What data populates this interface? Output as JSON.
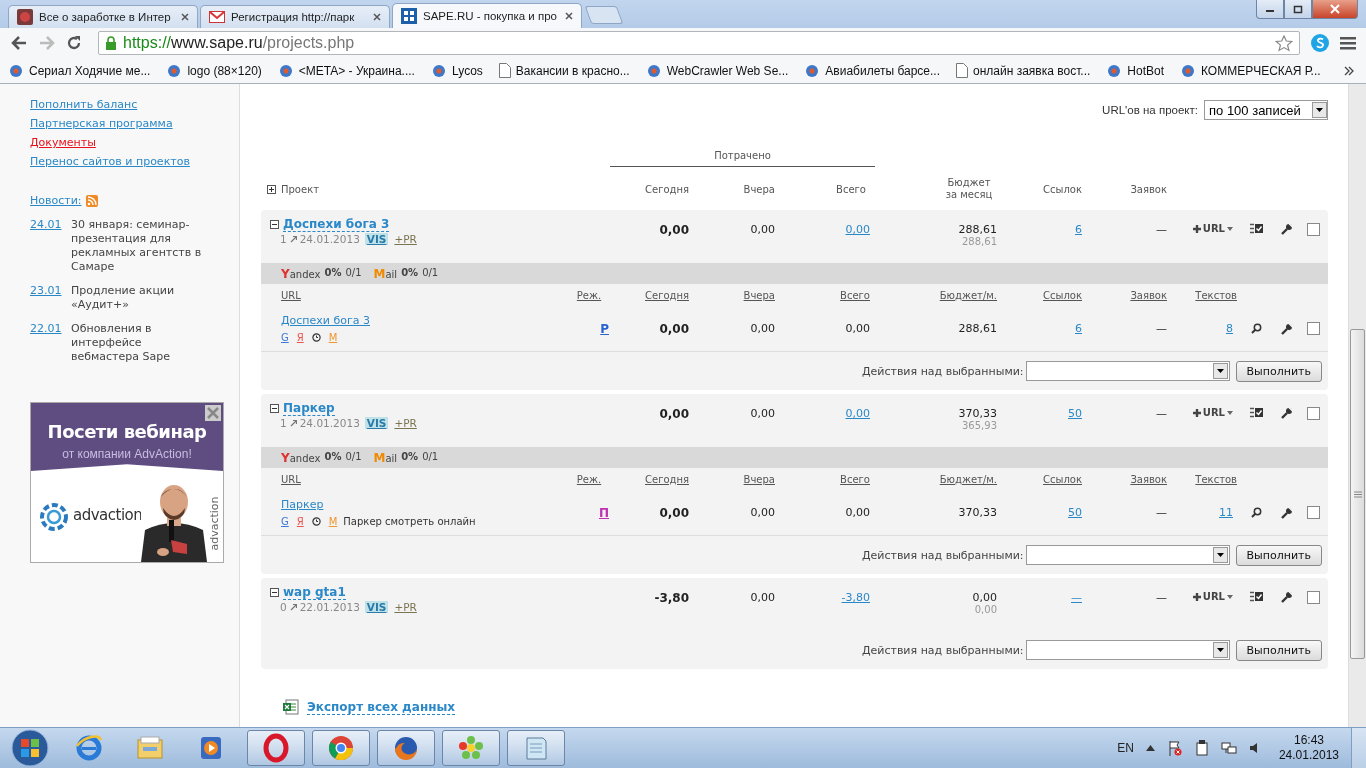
{
  "browser": {
    "tabs": [
      {
        "title": "Все о заработке в Интер",
        "kind": "site",
        "selected": false
      },
      {
        "title": "Регистрация http://парк",
        "kind": "mail",
        "selected": false
      },
      {
        "title": "SAPE.RU - покупка и про",
        "kind": "sape",
        "selected": true
      }
    ],
    "url": {
      "scheme": "https://",
      "host": "www.sape.ru",
      "path": "/projects.php"
    },
    "bookmarks": [
      {
        "label": "Сериал Ходячие ме...",
        "kind": "site"
      },
      {
        "label": "logo (88×120)",
        "kind": "site"
      },
      {
        "label": "<META> - Украина....",
        "kind": "site"
      },
      {
        "label": "Lycos",
        "kind": "site"
      },
      {
        "label": "Вакансии в красно...",
        "kind": "page"
      },
      {
        "label": "WebCrawler Web Se...",
        "kind": "site"
      },
      {
        "label": "Авиабилеты барсе...",
        "kind": "site"
      },
      {
        "label": "онлайн заявка вост...",
        "kind": "page"
      },
      {
        "label": "HotBot",
        "kind": "site"
      },
      {
        "label": "КОММЕРЧЕСКАЯ Р...",
        "kind": "site"
      }
    ]
  },
  "sidebar": {
    "links": [
      {
        "label": "Пополнить баланс",
        "selected": false
      },
      {
        "label": "Партнерская программа",
        "selected": false
      },
      {
        "label": "Документы",
        "selected": true
      },
      {
        "label": "Перенос сайтов и проектов",
        "selected": false
      }
    ],
    "news_title": "Новости:",
    "news": [
      {
        "date": "24.01",
        "text": "30 января: семинар-презентация для рекламных агентств в Самаре"
      },
      {
        "date": "23.01",
        "text": "Продление акции «Аудит+»"
      },
      {
        "date": "22.01",
        "text": "Обновления в интерфейсе вебмастера Sape"
      }
    ],
    "banner": {
      "heading": "Посети вебинар",
      "subheading": "от компании AdvAction!",
      "logo": "advaction",
      "side_text": "advaction"
    }
  },
  "main": {
    "per_page": {
      "label": "URL'ов на проект:",
      "value": "по 100 записей"
    },
    "header": {
      "project": "Проект",
      "spent": "Потрачено",
      "today": "Сегодня",
      "yesterday": "Вчера",
      "total": "Всего",
      "budget": "Бюджет за месяц",
      "links": "Ссылок",
      "requests": "Заявок"
    },
    "projects": [
      {
        "name": "Доспехи бога 3",
        "pages": "1",
        "date": "24.01.2013",
        "vis": "VIS",
        "pr": "+PR",
        "today": "0,00",
        "yesterday": "0,00",
        "total": "0,00",
        "budget": "288,61",
        "budget_sub": "288,61",
        "links": "6",
        "requests": "—",
        "url_menu": "URL",
        "expanded": true,
        "checked": false,
        "engines": [
          {
            "initial": "Y",
            "name": "andex",
            "percent": "0%",
            "ratio": "0/1",
            "color": "#e03030"
          },
          {
            "initial": "M",
            "name": "ail",
            "percent": "0%",
            "ratio": "0/1",
            "color": "#f08a00"
          }
        ],
        "url_columns": [
          "URL",
          "Реж.",
          "Сегодня",
          "Вчера",
          "Всего",
          "Бюджет/м.",
          "Ссылок",
          "Заявок",
          "Текстов"
        ],
        "urls": [
          {
            "name": "Доспехи бога 3",
            "flags": [
              {
                "kind": "google",
                "label": "G"
              },
              {
                "kind": "yandex",
                "label": "Я"
              },
              {
                "kind": "clock"
              },
              {
                "kind": "mail",
                "label": "M"
              }
            ],
            "mode": {
              "label": "P",
              "color": "#2a62d0"
            },
            "today": "0,00",
            "yesterday": "0,00",
            "total": "0,00",
            "budget": "288,61",
            "links": "6",
            "requests": "—",
            "texts": "8",
            "checked": false
          }
        ],
        "actions_label": "Действия над выбранными:",
        "submit": "Выполнить"
      },
      {
        "name": "Паркер",
        "pages": "1",
        "date": "24.01.2013",
        "vis": "VIS",
        "pr": "+PR",
        "today": "0,00",
        "yesterday": "0,00",
        "total": "0,00",
        "budget": "370,33",
        "budget_sub": "365,93",
        "links": "50",
        "requests": "—",
        "url_menu": "URL",
        "expanded": true,
        "checked": false,
        "engines": [
          {
            "initial": "Y",
            "name": "andex",
            "percent": "0%",
            "ratio": "0/1",
            "color": "#e03030"
          },
          {
            "initial": "M",
            "name": "ail",
            "percent": "0%",
            "ratio": "0/1",
            "color": "#f08a00"
          }
        ],
        "url_columns": [
          "URL",
          "Реж.",
          "Сегодня",
          "Вчера",
          "Всего",
          "Бюджет/м.",
          "Ссылок",
          "Заявок",
          "Текстов"
        ],
        "urls": [
          {
            "name": "Паркер",
            "flags": [
              {
                "kind": "google",
                "label": "G"
              },
              {
                "kind": "yandex",
                "label": "Я"
              },
              {
                "kind": "clock"
              },
              {
                "kind": "mail",
                "label": "M"
              }
            ],
            "note": "Паркер смотреть онлайн",
            "mode": {
              "label": "П",
              "color": "#c030b0"
            },
            "today": "0,00",
            "yesterday": "0,00",
            "total": "0,00",
            "budget": "370,33",
            "links": "50",
            "requests": "—",
            "texts": "11",
            "checked": false
          }
        ],
        "actions_label": "Действия над выбранными:",
        "submit": "Выполнить"
      },
      {
        "name": "wap gta1",
        "pages": "0",
        "date": "22.01.2013",
        "vis": "VIS",
        "pr": "+PR",
        "today": "-3,80",
        "yesterday": "0,00",
        "total": "-3,80",
        "budget": "0,00",
        "budget_sub": "0,00",
        "links": "—",
        "requests": "—",
        "url_menu": "URL",
        "expanded": true,
        "checked": false,
        "actions_label": "Действия над выбранными:",
        "submit": "Выполнить"
      }
    ],
    "export": "Экспорт всех данных"
  },
  "taskbar": {
    "apps": [
      {
        "kind": "ie",
        "running": false
      },
      {
        "kind": "explorer",
        "running": false
      },
      {
        "kind": "media",
        "running": false
      },
      {
        "kind": "opera",
        "running": true
      },
      {
        "kind": "chrome",
        "running": true
      },
      {
        "kind": "firefox",
        "running": true
      },
      {
        "kind": "icq",
        "running": true
      },
      {
        "kind": "notepad",
        "running": true
      }
    ],
    "language": "EN",
    "time": "16:43",
    "date": "24.01.2013"
  }
}
